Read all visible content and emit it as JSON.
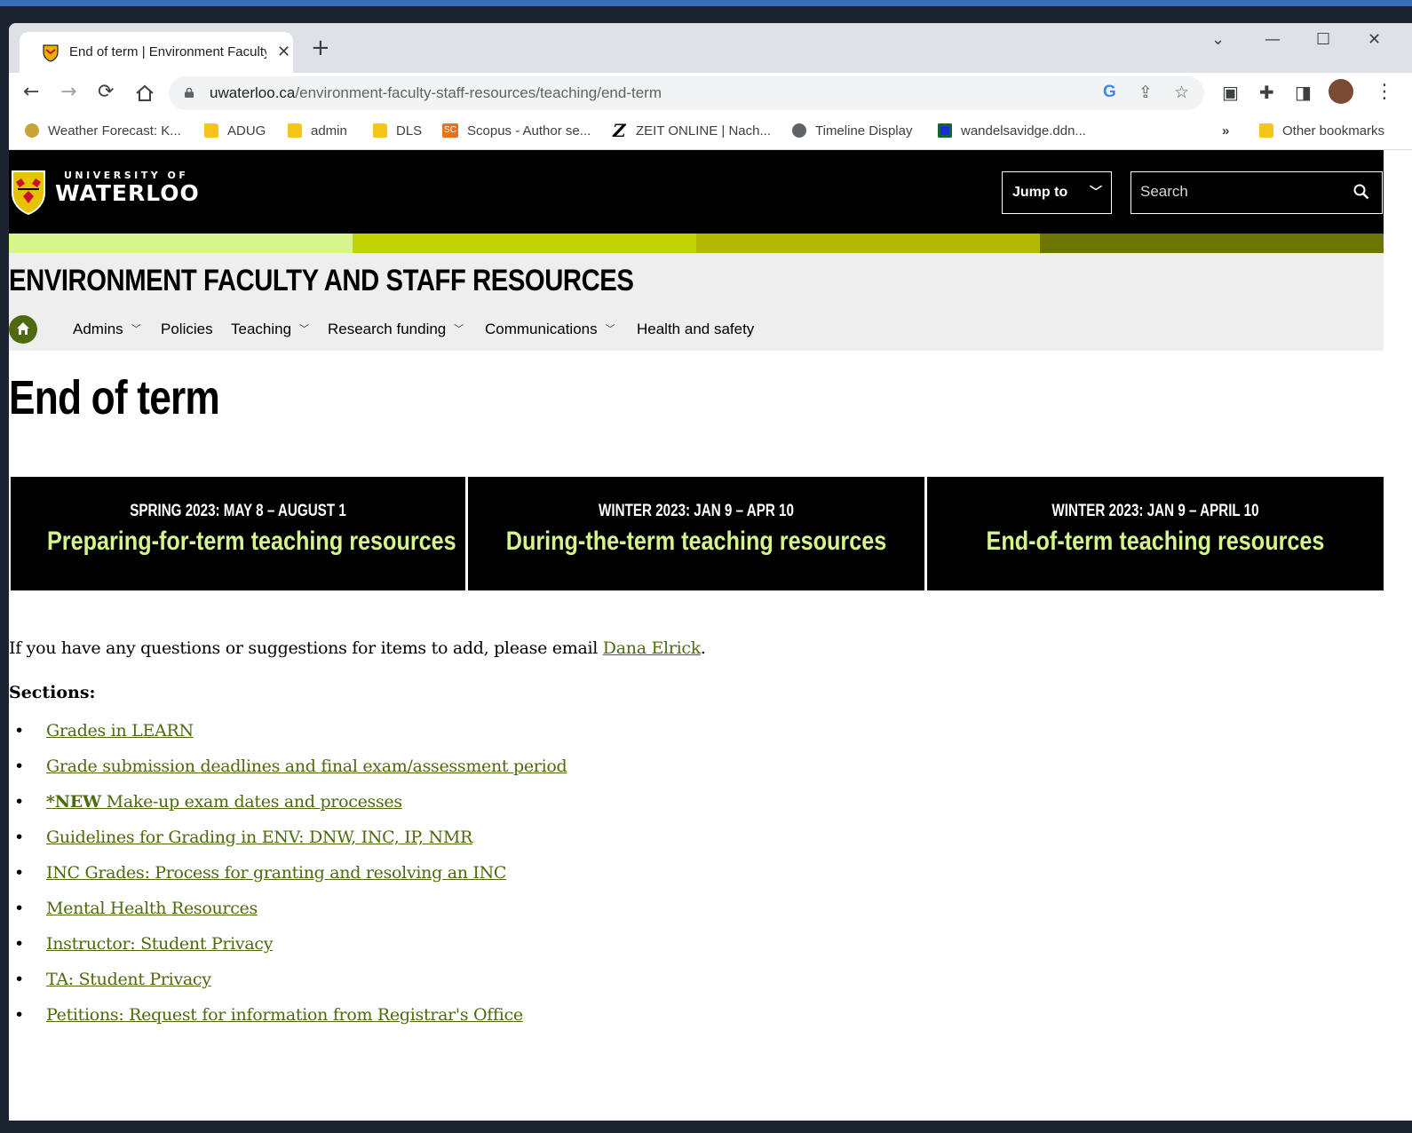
{
  "browser": {
    "tab_title": "End of term | Environment Faculty and Staff Resources | University of Waterloo",
    "new_tab": "+",
    "url_host": "uwaterloo.ca",
    "url_path": "/environment-faculty-staff-resources/teaching/end-term",
    "bookmarks": [
      {
        "label": "Weather Forecast: K...",
        "icon": "weather-icon"
      },
      {
        "label": "ADUG",
        "icon": "folder-icon"
      },
      {
        "label": "admin",
        "icon": "folder-icon"
      },
      {
        "label": "DLS",
        "icon": "folder-icon"
      },
      {
        "label": "Scopus - Author se...",
        "icon": "scopus-icon",
        "badge": "SC"
      },
      {
        "label": "ZEIT ONLINE | Nach...",
        "icon": "zeit-icon",
        "badge": "Z"
      },
      {
        "label": "Timeline Display",
        "icon": "globe-icon"
      },
      {
        "label": "wandelsavidge.ddn...",
        "icon": "site-icon"
      }
    ],
    "bookmarks_overflow": "»",
    "other_bookmarks": "Other bookmarks",
    "colors": {
      "chrome": "#dee1e6",
      "omnibox": "#f1f3f4"
    }
  },
  "site": {
    "logo_small": "UNIVERSITY OF",
    "logo_big": "WATERLOO",
    "jump_to": "Jump to",
    "search_placeholder": "Search",
    "stripe_colors": [
      "#d7f58a",
      "#c1d600",
      "#b3b800",
      "#6b7500"
    ],
    "faculty_title": "ENVIRONMENT FACULTY AND STAFF RESOURCES",
    "nav": [
      {
        "label": "Admins",
        "dropdown": true
      },
      {
        "label": "Policies",
        "dropdown": false
      },
      {
        "label": "Teaching",
        "dropdown": true
      },
      {
        "label": "Research funding",
        "dropdown": true
      },
      {
        "label": "Communications",
        "dropdown": true
      },
      {
        "label": "Health and safety",
        "dropdown": false
      }
    ]
  },
  "main": {
    "title": "End of term",
    "cards": [
      {
        "date": "SPRING 2023: MAY 8 – AUGUST 1",
        "link": "Preparing-for-term teaching resources"
      },
      {
        "date": "WINTER 2023: JAN 9 – APR 10",
        "link": "During-the-term teaching resources"
      },
      {
        "date": "WINTER 2023: JAN 9 – APRIL 10",
        "link": "End-of-term teaching resources"
      }
    ],
    "intro_text": "If you have any questions or suggestions for items to add, please email ",
    "intro_link": "Dana Elrick",
    "intro_end": ".",
    "sections_label": "Sections:",
    "new_badge": "*NEW",
    "sections": [
      "Grades in LEARN",
      "Grade submission deadlines and final exam/assessment period",
      " Make-up exam dates and processes",
      "Guidelines for Grading in ENV: DNW, INC, IP, NMR",
      "INC Grades: Process for granting and resolving an INC",
      "Mental Health Resources",
      "Instructor: Student Privacy",
      "TA: Student Privacy",
      "Petitions: Request for information from Registrar's Office"
    ],
    "link_color": "#4d6a10",
    "card_link_color": "#d5f48c"
  }
}
